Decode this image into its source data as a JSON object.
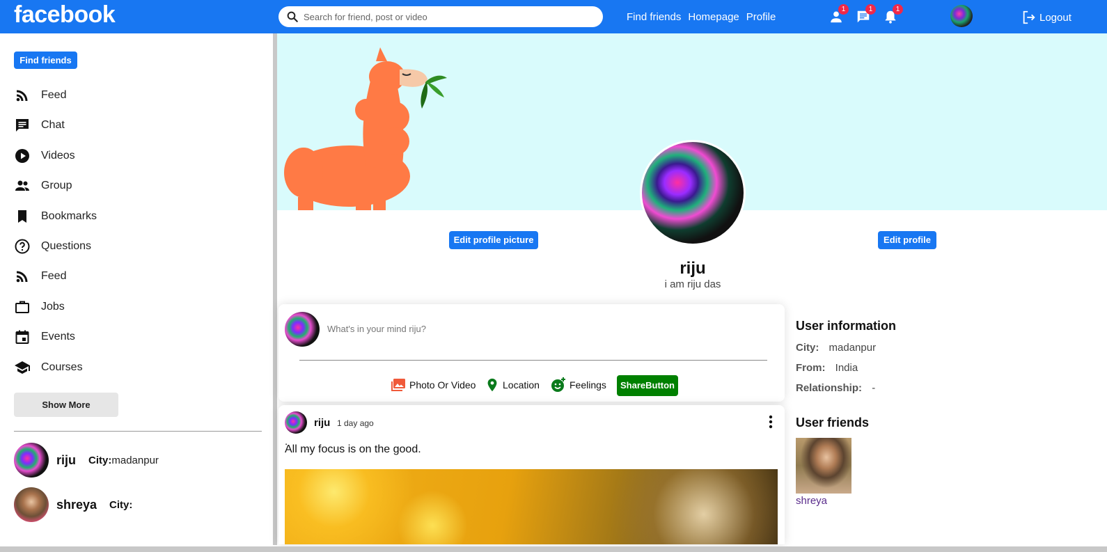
{
  "topbar": {
    "logo": "facebook",
    "search_placeholder": "Search for friend, post or video",
    "nav": [
      "Find friends",
      "Homepage",
      "Profile"
    ],
    "badges": {
      "friends": "1",
      "messages": "1",
      "notifications": "1"
    },
    "logout": "Logout",
    "brand_color": "#1877f2"
  },
  "sidebar": {
    "find_friends": "Find friends",
    "items": [
      {
        "label": "Feed",
        "icon": "rss-icon"
      },
      {
        "label": "Chat",
        "icon": "chat-icon"
      },
      {
        "label": "Videos",
        "icon": "play-circle-icon"
      },
      {
        "label": "Group",
        "icon": "group-icon"
      },
      {
        "label": "Bookmarks",
        "icon": "bookmark-icon"
      },
      {
        "label": "Questions",
        "icon": "help-circle-icon"
      },
      {
        "label": "Feed",
        "icon": "rss-icon"
      },
      {
        "label": "Jobs",
        "icon": "briefcase-icon"
      },
      {
        "label": "Events",
        "icon": "calendar-icon"
      },
      {
        "label": "Courses",
        "icon": "school-icon"
      }
    ],
    "show_more": "Show More",
    "friends": [
      {
        "name": "riju",
        "city_label": "City:",
        "city": "madanpur"
      },
      {
        "name": "shreya",
        "city_label": "City:",
        "city": ""
      }
    ]
  },
  "profile": {
    "edit_picture": "Edit profile picture",
    "edit_profile": "Edit profile",
    "name": "riju",
    "description": "i am riju das",
    "cover_color": "#d9fbfc"
  },
  "share": {
    "placeholder": "What's in your mind riju?",
    "options": [
      "Photo Or Video",
      "Location",
      "Feelings"
    ],
    "share_button": "ShareButton",
    "share_color": "#008000"
  },
  "post": {
    "user": "riju",
    "time": "1 day ago",
    "dot": ".",
    "text": "All my focus is on the good."
  },
  "user_info": {
    "title": "User information",
    "rows": [
      {
        "key": "City:",
        "value": "madanpur"
      },
      {
        "key": "From:",
        "value": "India"
      },
      {
        "key": "Relationship:",
        "value": "-"
      }
    ]
  },
  "user_friends": {
    "title": "User friends",
    "items": [
      {
        "name": "shreya"
      }
    ]
  }
}
